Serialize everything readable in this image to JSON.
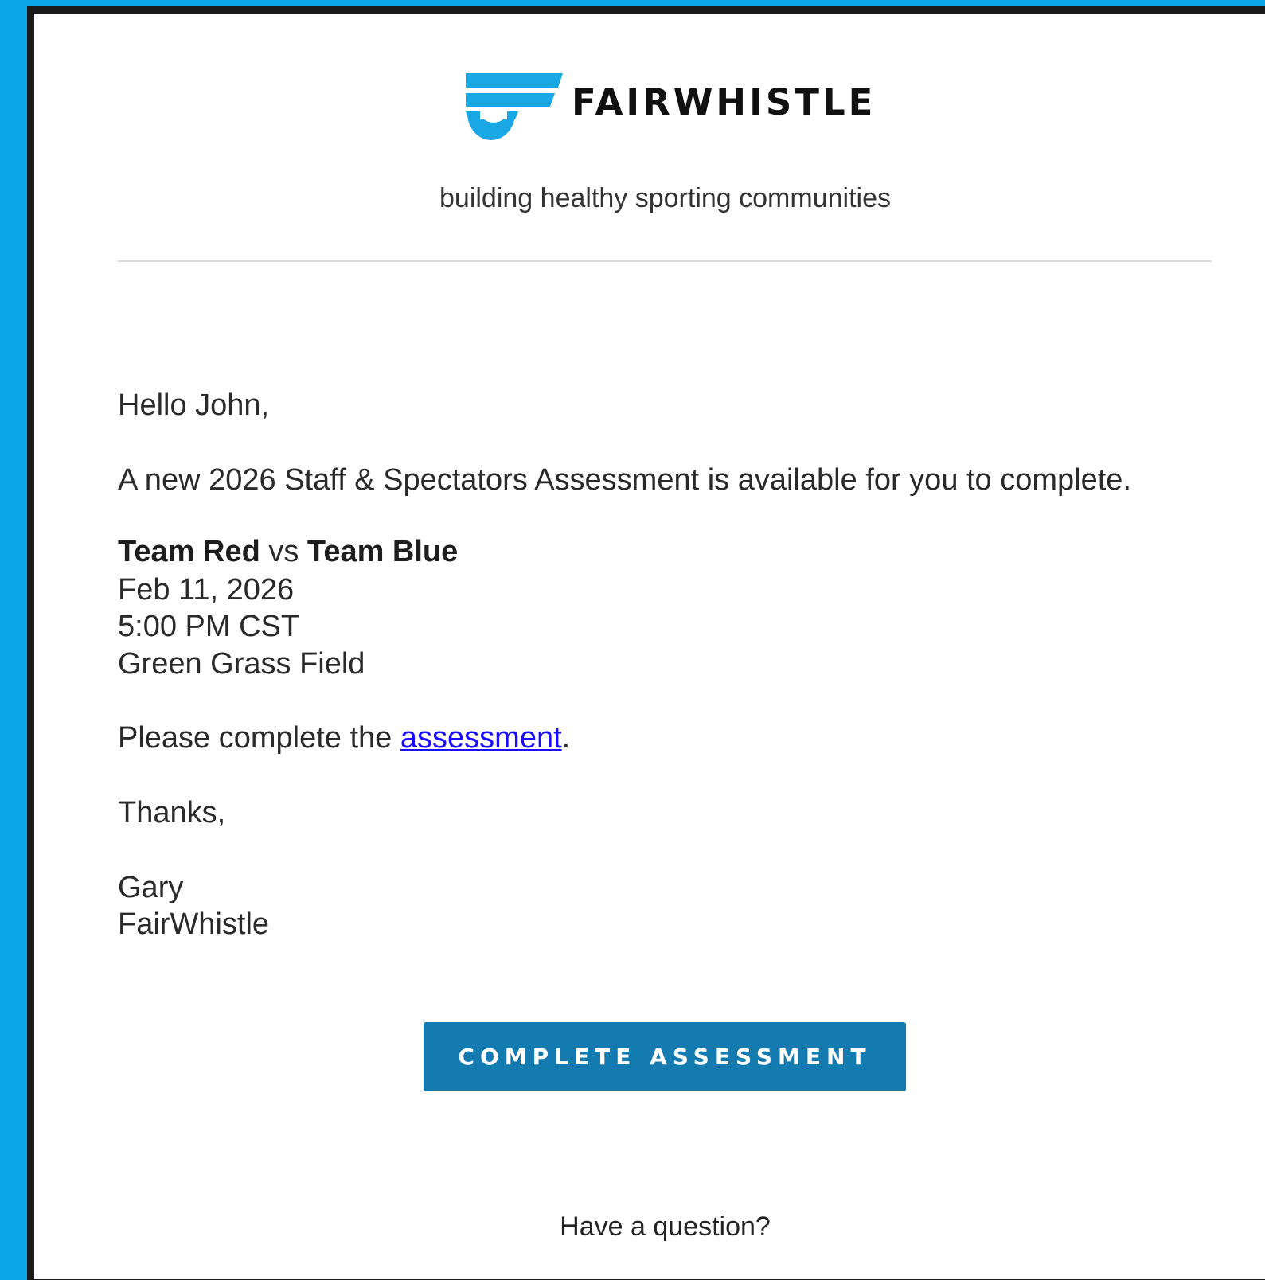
{
  "brand": {
    "logo_name": "fairwhistle-logo",
    "wordmark": "FAIRWHISTLE",
    "tagline": "building healthy sporting communities",
    "accent_color": "#1aa7e6",
    "button_color": "#147bb0"
  },
  "email": {
    "greeting": "Hello John,",
    "intro": "A new 2026 Staff & Spectators Assessment is available for you to complete.",
    "match": {
      "team_a": "Team Red",
      "vs": "vs",
      "team_b": "Team Blue",
      "date": "Feb 11, 2026",
      "time": "5:00 PM CST",
      "venue": "Green Grass Field"
    },
    "cta_sentence_prefix": "Please complete the",
    "cta_link": "assessment",
    "cta_sentence_suffix": ".",
    "signoff": "Thanks,",
    "sender_name": "Gary",
    "sender_org": "FairWhistle",
    "button_label": "COMPLETE ASSESSMENT",
    "footer_question": "Have a question?"
  }
}
